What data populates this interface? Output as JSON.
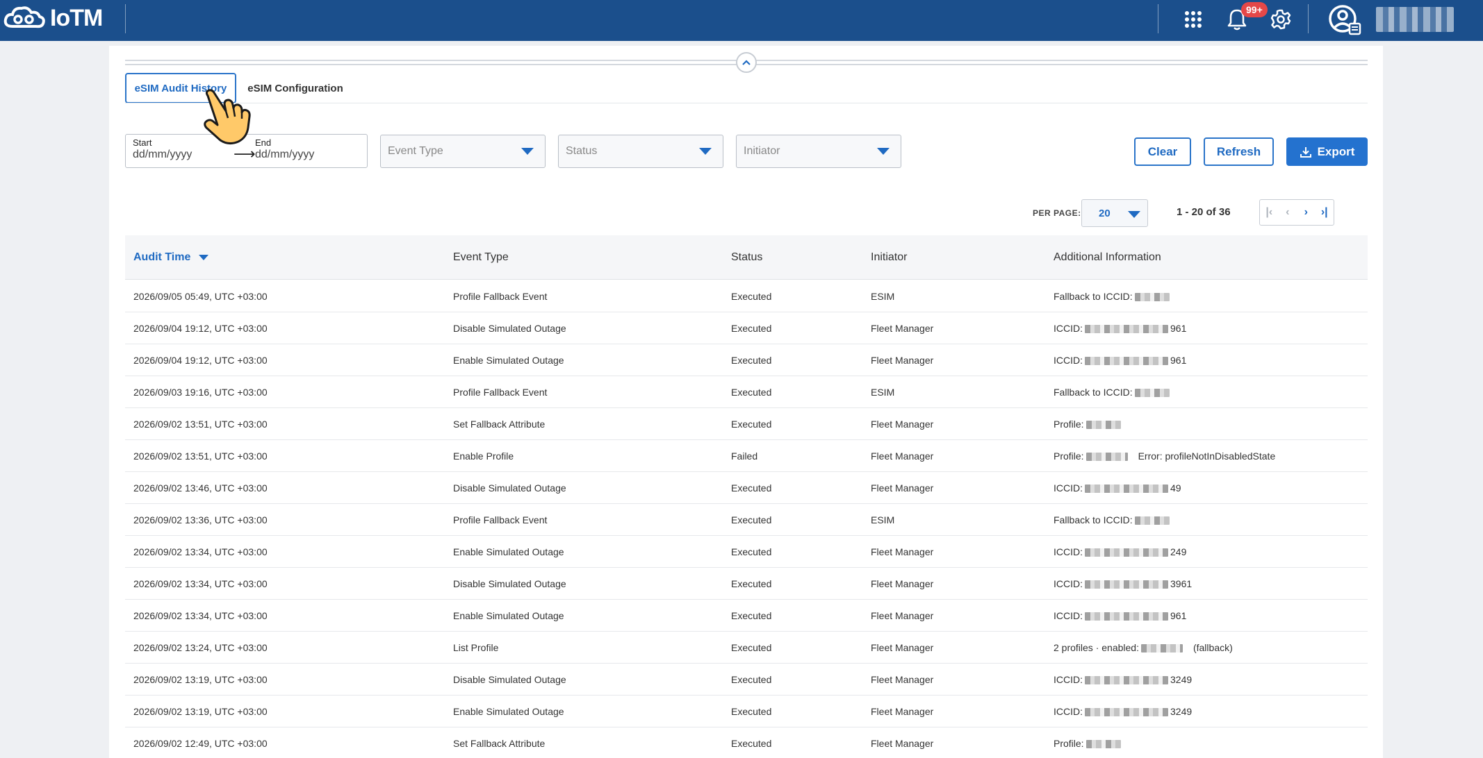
{
  "app": {
    "logo_text": "IoTM",
    "notification_count": "99+"
  },
  "tabs": [
    {
      "label": "eSIM Audit History",
      "active": true
    },
    {
      "label": "eSIM Configuration",
      "active": false
    }
  ],
  "filters": {
    "start_label": "Start",
    "start_placeholder": "dd/mm/yyyy",
    "end_label": "End",
    "end_placeholder": "dd/mm/yyyy",
    "event_type_placeholder": "Event Type",
    "status_placeholder": "Status",
    "initiator_placeholder": "Initiator"
  },
  "actions": {
    "clear_label": "Clear",
    "refresh_label": "Refresh",
    "export_label": "Export"
  },
  "pagination": {
    "per_page_label": "PER PAGE:",
    "per_page_value": "20",
    "range_text": "1 - 20 of 36"
  },
  "table": {
    "columns": [
      "Audit Time",
      "Event Type",
      "Status",
      "Initiator",
      "Additional Information"
    ],
    "rows": [
      {
        "time": "2026/09/05 05:49, UTC +03:00",
        "event": "Profile Fallback Event",
        "status": "Executed",
        "initiator": "ESIM",
        "info_prefix": "Fallback to ICCID:",
        "info_suffix": ""
      },
      {
        "time": "2026/09/04 19:12, UTC +03:00",
        "event": "Disable Simulated Outage",
        "status": "Executed",
        "initiator": "Fleet Manager",
        "info_prefix": "ICCID:",
        "info_suffix": "961"
      },
      {
        "time": "2026/09/04 19:12, UTC +03:00",
        "event": "Enable Simulated Outage",
        "status": "Executed",
        "initiator": "Fleet Manager",
        "info_prefix": "ICCID:",
        "info_suffix": "961"
      },
      {
        "time": "2026/09/03 19:16, UTC +03:00",
        "event": "Profile Fallback Event",
        "status": "Executed",
        "initiator": "ESIM",
        "info_prefix": "Fallback to ICCID:",
        "info_suffix": ""
      },
      {
        "time": "2026/09/02 13:51, UTC +03:00",
        "event": "Set Fallback Attribute",
        "status": "Executed",
        "initiator": "Fleet Manager",
        "info_prefix": "Profile:",
        "info_suffix": ""
      },
      {
        "time": "2026/09/02 13:51, UTC +03:00",
        "event": "Enable Profile",
        "status": "Failed",
        "initiator": "Fleet Manager",
        "info_prefix": "Profile:",
        "info_suffix": "Error: profileNotInDisabledState"
      },
      {
        "time": "2026/09/02 13:46, UTC +03:00",
        "event": "Disable Simulated Outage",
        "status": "Executed",
        "initiator": "Fleet Manager",
        "info_prefix": "ICCID:",
        "info_suffix": "49"
      },
      {
        "time": "2026/09/02 13:36, UTC +03:00",
        "event": "Profile Fallback Event",
        "status": "Executed",
        "initiator": "ESIM",
        "info_prefix": "Fallback to ICCID:",
        "info_suffix": ""
      },
      {
        "time": "2026/09/02 13:34, UTC +03:00",
        "event": "Enable Simulated Outage",
        "status": "Executed",
        "initiator": "Fleet Manager",
        "info_prefix": "ICCID:",
        "info_suffix": "249"
      },
      {
        "time": "2026/09/02 13:34, UTC +03:00",
        "event": "Disable Simulated Outage",
        "status": "Executed",
        "initiator": "Fleet Manager",
        "info_prefix": "ICCID:",
        "info_suffix": "3961"
      },
      {
        "time": "2026/09/02 13:34, UTC +03:00",
        "event": "Enable Simulated Outage",
        "status": "Executed",
        "initiator": "Fleet Manager",
        "info_prefix": "ICCID:",
        "info_suffix": "961"
      },
      {
        "time": "2026/09/02 13:24, UTC +03:00",
        "event": "List Profile",
        "status": "Executed",
        "initiator": "Fleet Manager",
        "info_prefix": "2 profiles · enabled:",
        "info_suffix": "(fallback)"
      },
      {
        "time": "2026/09/02 13:19, UTC +03:00",
        "event": "Disable Simulated Outage",
        "status": "Executed",
        "initiator": "Fleet Manager",
        "info_prefix": "ICCID:",
        "info_suffix": "3249"
      },
      {
        "time": "2026/09/02 13:19, UTC +03:00",
        "event": "Enable Simulated Outage",
        "status": "Executed",
        "initiator": "Fleet Manager",
        "info_prefix": "ICCID:",
        "info_suffix": "3249"
      },
      {
        "time": "2026/09/02 12:49, UTC +03:00",
        "event": "Set Fallback Attribute",
        "status": "Executed",
        "initiator": "Fleet Manager",
        "info_prefix": "Profile:",
        "info_suffix": ""
      }
    ]
  }
}
